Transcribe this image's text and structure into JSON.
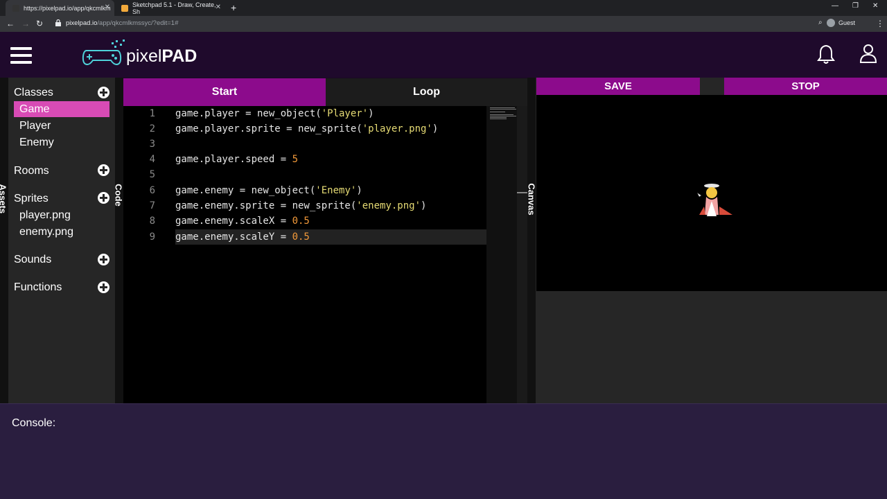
{
  "browser": {
    "tabs": [
      {
        "title": "https://pixelpad.io/app/qkcmlkm",
        "active": true
      },
      {
        "title": "Sketchpad 5.1 - Draw, Create, Sh",
        "active": false
      }
    ],
    "url_host": "pixelpad.io",
    "url_path": "/app/qkcmlkmssyc/?edit=1#",
    "profile": "Guest"
  },
  "app": {
    "logo_light": "pixel",
    "logo_bold": "PAD"
  },
  "sidebar": {
    "vertical_label": "Assets",
    "sections": [
      {
        "label": "Classes",
        "items": [
          "Game",
          "Player",
          "Enemy"
        ]
      },
      {
        "label": "Rooms",
        "items": []
      },
      {
        "label": "Sprites",
        "items": [
          "player.png",
          "enemy.png"
        ]
      },
      {
        "label": "Sounds",
        "items": []
      },
      {
        "label": "Functions",
        "items": []
      }
    ],
    "selected": "Game"
  },
  "editor": {
    "vertical_label": "Code",
    "tabs": [
      "Start",
      "Loop"
    ],
    "active_tab": "Start",
    "lines": [
      {
        "num": "1",
        "code": "game.player = new_object('Player')"
      },
      {
        "num": "2",
        "code": "game.player.sprite = new_sprite('player.png')"
      },
      {
        "num": "3",
        "code": ""
      },
      {
        "num": "4",
        "code": "game.player.speed = 5"
      },
      {
        "num": "5",
        "code": ""
      },
      {
        "num": "6",
        "code": "game.enemy = new_object('Enemy')"
      },
      {
        "num": "7",
        "code": "game.enemy.sprite = new_sprite('enemy.png')"
      },
      {
        "num": "8",
        "code": "game.enemy.scaleX = 0.5"
      },
      {
        "num": "9",
        "code": "game.enemy.scaleY = 0.5"
      }
    ]
  },
  "canvas": {
    "vertical_label": "Canvas",
    "save_label": "SAVE",
    "stop_label": "STOP"
  },
  "console": {
    "label": "Console:"
  },
  "colors": {
    "accent": "#8c0b8c",
    "selected": "#d84bb5",
    "header_bg": "#1f0a2c",
    "console_bg": "#2a1e3f"
  }
}
